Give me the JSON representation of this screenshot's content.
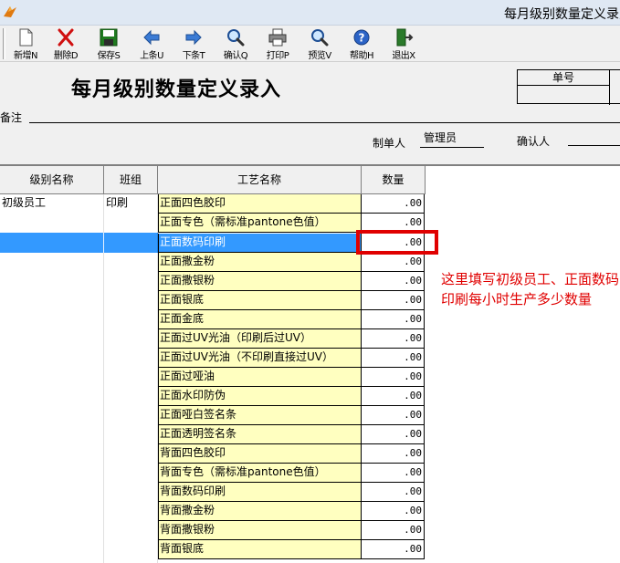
{
  "window": {
    "title": "每月级别数量定义录入"
  },
  "toolbar": {
    "buttons": [
      {
        "id": "new",
        "label": "新增N",
        "icon": "new-document-icon"
      },
      {
        "id": "delete",
        "label": "删除D",
        "icon": "delete-x-icon"
      },
      {
        "id": "save",
        "label": "保存S",
        "icon": "save-disk-icon"
      },
      {
        "id": "prev",
        "label": "上条U",
        "icon": "arrow-left-icon"
      },
      {
        "id": "next",
        "label": "下条T",
        "icon": "arrow-right-icon"
      },
      {
        "id": "confirm",
        "label": "确认Q",
        "icon": "magnifier-icon"
      },
      {
        "id": "print",
        "label": "打印P",
        "icon": "printer-icon"
      },
      {
        "id": "preview",
        "label": "预览V",
        "icon": "magnifier-icon"
      },
      {
        "id": "help",
        "label": "帮助H",
        "icon": "help-icon"
      },
      {
        "id": "exit",
        "label": "退出X",
        "icon": "exit-door-icon"
      }
    ]
  },
  "form": {
    "title": "每月级别数量定义录入",
    "order_no_label": "单号",
    "order_no_value": "",
    "remark_label": "备注",
    "remark_value": "",
    "maker_label": "制单人",
    "maker_value": "管理员",
    "confirmer_label": "确认人",
    "confirmer_value": ""
  },
  "grid": {
    "headers": {
      "level": "级别名称",
      "group": "班组",
      "process": "工艺名称",
      "quantity": "数量"
    },
    "left_rows": [
      {
        "level": "初级员工",
        "group": "印刷"
      }
    ],
    "selected_row_index": 2,
    "process_rows": [
      {
        "name": "正面四色胶印",
        "qty": ".00"
      },
      {
        "name": "正面专色（需标准pantone色值）",
        "qty": ".00"
      },
      {
        "name": "正面数码印刷",
        "qty": ".00"
      },
      {
        "name": "正面撒金粉",
        "qty": ".00"
      },
      {
        "name": "正面撒银粉",
        "qty": ".00"
      },
      {
        "name": "正面银底",
        "qty": ".00"
      },
      {
        "name": "正面金底",
        "qty": ".00"
      },
      {
        "name": "正面过UV光油（印刷后过UV）",
        "qty": ".00"
      },
      {
        "name": "正面过UV光油（不印刷直接过UV）",
        "qty": ".00"
      },
      {
        "name": "正面过哑油",
        "qty": ".00"
      },
      {
        "name": "正面水印防伪",
        "qty": ".00"
      },
      {
        "name": "正面哑白签名条",
        "qty": ".00"
      },
      {
        "name": "正面透明签名条",
        "qty": ".00"
      },
      {
        "name": "背面四色胶印",
        "qty": ".00"
      },
      {
        "name": "背面专色（需标准pantone色值）",
        "qty": ".00"
      },
      {
        "name": "背面数码印刷",
        "qty": ".00"
      },
      {
        "name": "背面撒金粉",
        "qty": ".00"
      },
      {
        "name": "背面撒银粉",
        "qty": ".00"
      },
      {
        "name": "背面银底",
        "qty": ".00"
      }
    ]
  },
  "annotation": {
    "text": "这里填写初级员工、正面数码印刷每小时生产多少数量",
    "color": "#e00000"
  },
  "colors": {
    "selection": "#3399ff",
    "name_cell_bg": "#ffffc0",
    "highlight_border": "#e00000"
  }
}
